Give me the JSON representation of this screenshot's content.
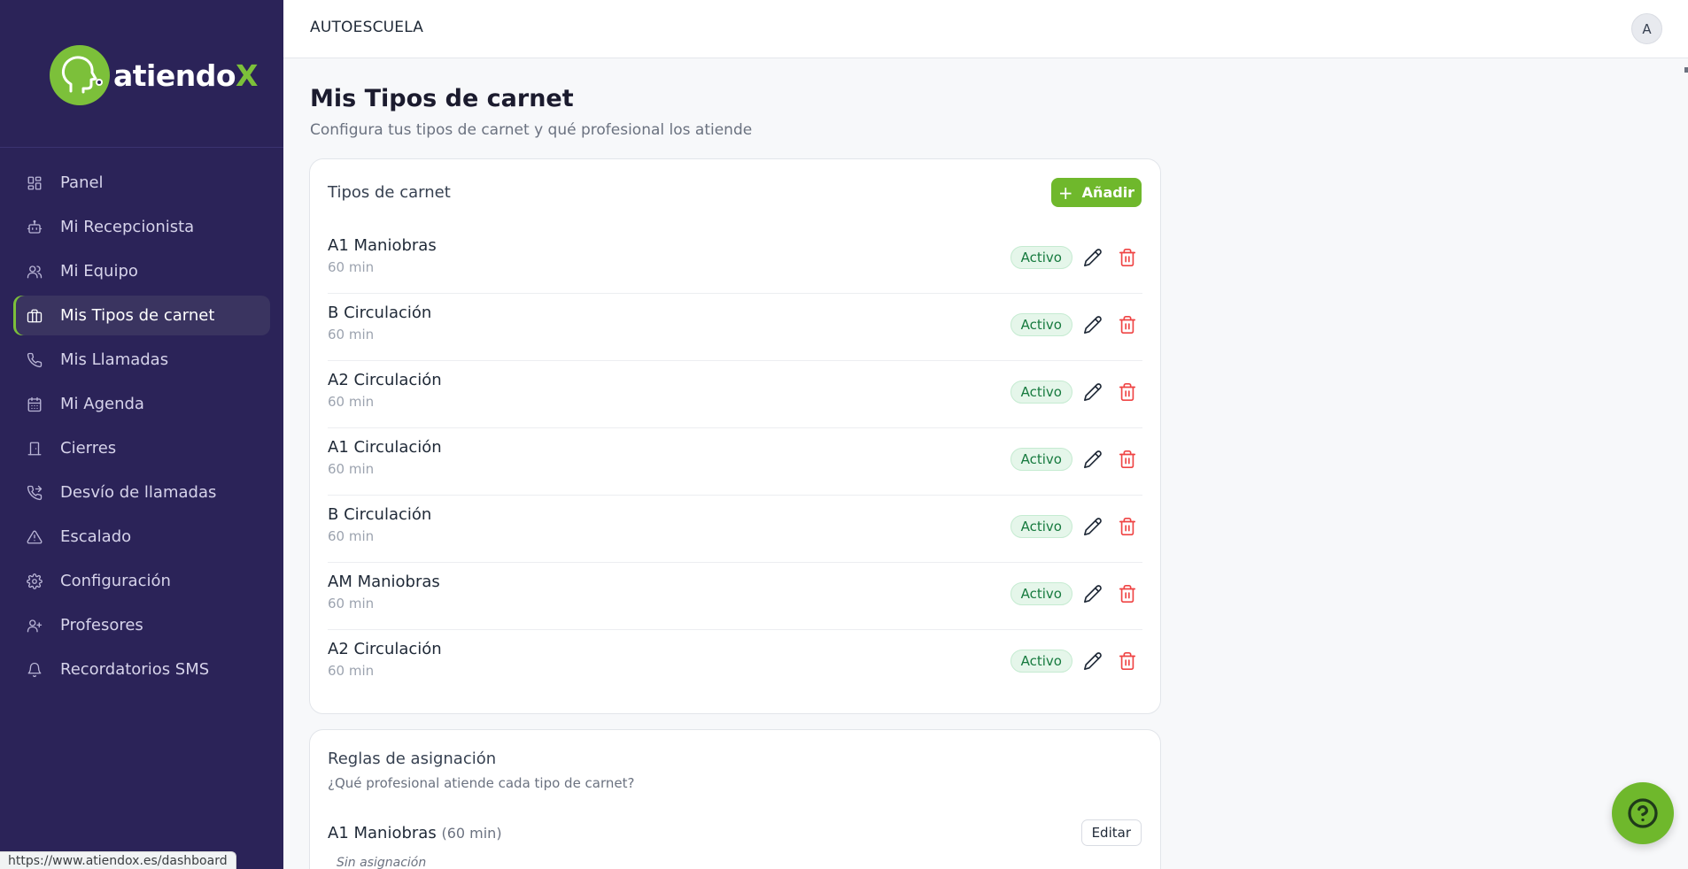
{
  "brand": {
    "name_main": "atiendo",
    "name_accent": "X",
    "accent_color": "#7cc03a",
    "sidebar_color": "#2b2358"
  },
  "sidebar": {
    "items": [
      {
        "label": "Panel",
        "icon": "dashboard-icon",
        "active": false
      },
      {
        "label": "Mi Recepcionista",
        "icon": "robot-icon",
        "active": false
      },
      {
        "label": "Mi Equipo",
        "icon": "users-icon",
        "active": false
      },
      {
        "label": "Mis Tipos de carnet",
        "icon": "briefcase-icon",
        "active": true
      },
      {
        "label": "Mis Llamadas",
        "icon": "phone-icon",
        "active": false
      },
      {
        "label": "Mi Agenda",
        "icon": "calendar-icon",
        "active": false
      },
      {
        "label": "Cierres",
        "icon": "door-icon",
        "active": false
      },
      {
        "label": "Desvío de llamadas",
        "icon": "phone-forward-icon",
        "active": false
      },
      {
        "label": "Escalado",
        "icon": "warning-icon",
        "active": false
      },
      {
        "label": "Configuración",
        "icon": "gear-icon",
        "active": false
      },
      {
        "label": "Profesores",
        "icon": "user-plus-icon",
        "active": false
      },
      {
        "label": "Recordatorios SMS",
        "icon": "bell-icon",
        "active": false
      }
    ]
  },
  "topbar": {
    "company": "AUTOESCUELA",
    "avatar_initial": "A"
  },
  "page": {
    "title": "Mis Tipos de carnet",
    "subtitle": "Configura tus tipos de carnet y qué profesional los atiende"
  },
  "types_card": {
    "title": "Tipos de carnet",
    "add_label": "Añadir",
    "rows": [
      {
        "name": "A1 Maniobras",
        "duration": "60 min",
        "status": "Activo"
      },
      {
        "name": "B Circulación",
        "duration": "60 min",
        "status": "Activo"
      },
      {
        "name": "A2 Circulación",
        "duration": "60 min",
        "status": "Activo"
      },
      {
        "name": "A1 Circulación",
        "duration": "60 min",
        "status": "Activo"
      },
      {
        "name": "B Circulación",
        "duration": "60 min",
        "status": "Activo"
      },
      {
        "name": "AM Maniobras",
        "duration": "60 min",
        "status": "Activo"
      },
      {
        "name": "A2 Circulación",
        "duration": "60 min",
        "status": "Activo"
      }
    ]
  },
  "rules_card": {
    "title": "Reglas de asignación",
    "subtitle": "¿Qué profesional atiende cada tipo de carnet?",
    "first_rule": {
      "name": "A1 Maniobras",
      "duration": "(60 min)",
      "edit_label": "Editar",
      "assignment": "Sin asignación"
    }
  },
  "status_bar": {
    "url": "https://www.atiendox.es/dashboard"
  }
}
